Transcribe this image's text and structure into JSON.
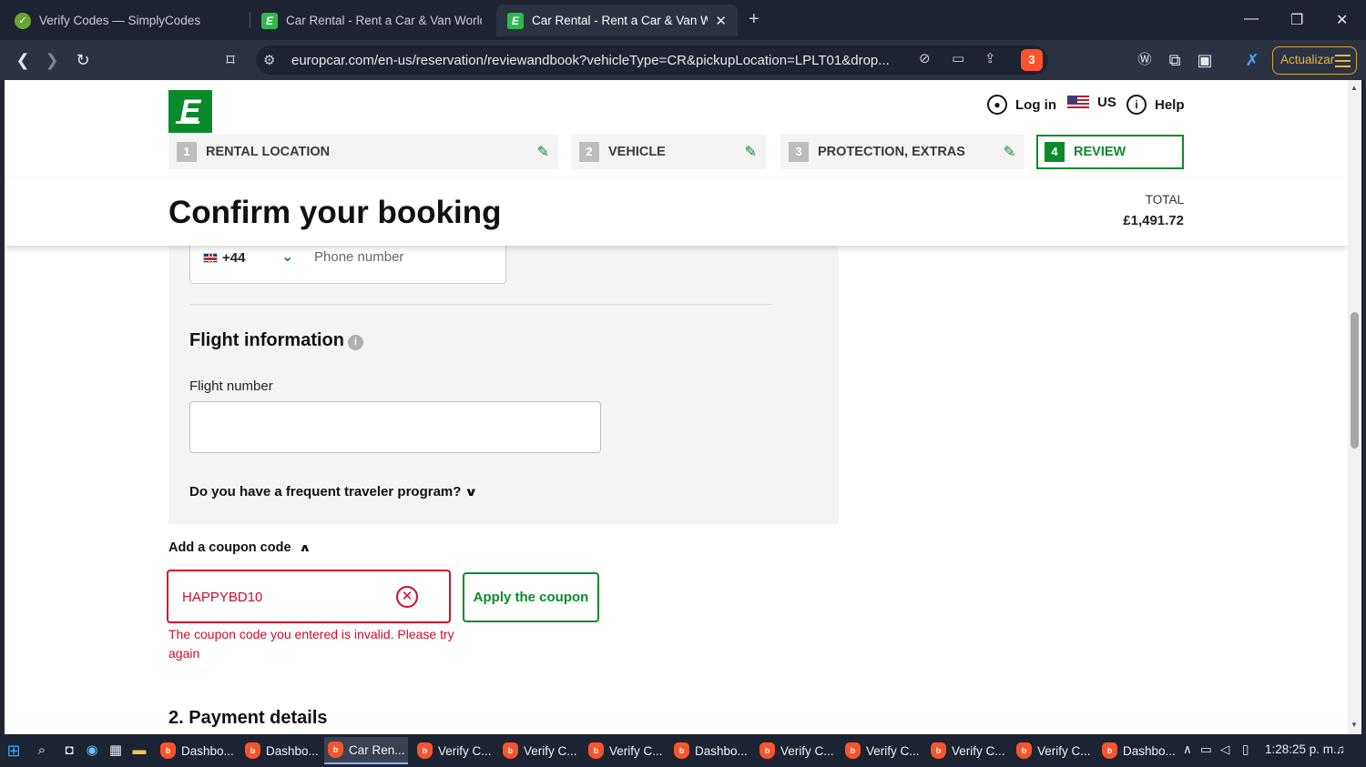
{
  "browser": {
    "tabs": [
      {
        "title": "Verify Codes — SimplyCodes",
        "icon": "simplycodes-check-icon"
      },
      {
        "title": "Car Rental - Rent a Car & Van Worldw",
        "icon": "europcar-favicon"
      },
      {
        "title": "Car Rental - Rent a Car & Van Wo",
        "icon": "europcar-favicon",
        "active": true
      }
    ],
    "url": "europcar.com/en-us/reservation/reviewandbook?vehicleType=CR&pickupLocation=LPLT01&drop...",
    "update_button": "Actualizar",
    "shield_count": "3"
  },
  "header": {
    "logo_letter": "E",
    "login": "Log in",
    "country": "US",
    "help": "Help"
  },
  "steps": [
    {
      "num": "1",
      "label": "RENTAL LOCATION"
    },
    {
      "num": "2",
      "label": "VEHICLE"
    },
    {
      "num": "3",
      "label": "PROTECTION, EXTRAS"
    },
    {
      "num": "4",
      "label": "REVIEW"
    }
  ],
  "booking": {
    "title": "Confirm your booking",
    "total_label": "TOTAL",
    "total_value": "£1,491.72"
  },
  "form": {
    "phone_code": "+44",
    "phone_placeholder": "Phone number",
    "flight_heading": "Flight information",
    "flight_label": "Flight number",
    "flight_value": "",
    "ftp_question": "Do you have a frequent traveler program?",
    "coupon_toggle": "Add a coupon code",
    "coupon_value": "HAPPYBD10",
    "apply_button": "Apply the coupon",
    "coupon_error": "The coupon code you entered is invalid. Please try again",
    "payment_heading": "2. Payment details"
  },
  "colors": {
    "brand_green": "#0d8a2a",
    "error_red": "#d20b2b"
  },
  "taskbar": {
    "items": [
      {
        "label": "Dashbo..."
      },
      {
        "label": "Dashbo..."
      },
      {
        "label": "Car Ren...",
        "active": true
      },
      {
        "label": "Verify C..."
      },
      {
        "label": "Verify C..."
      },
      {
        "label": "Verify C..."
      },
      {
        "label": "Dashbo..."
      },
      {
        "label": "Verify C..."
      },
      {
        "label": "Verify C..."
      },
      {
        "label": "Verify C..."
      },
      {
        "label": "Verify C..."
      },
      {
        "label": "Dashbo..."
      }
    ],
    "clock": "1:28:25 p. m."
  }
}
